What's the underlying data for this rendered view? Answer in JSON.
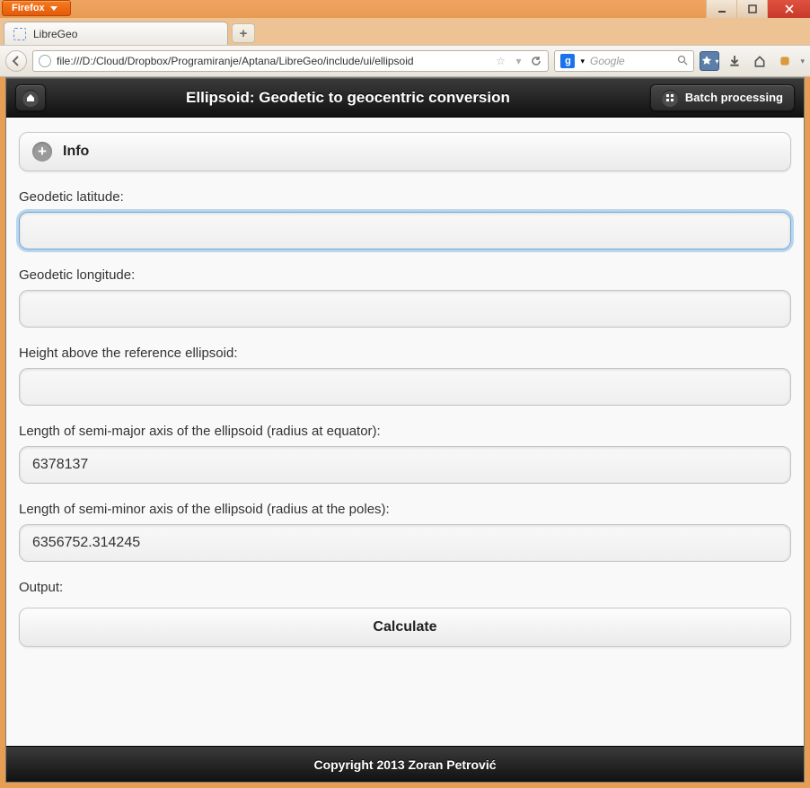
{
  "window": {
    "firefox_button": "Firefox",
    "tab_title": "LibreGeo",
    "url": "file:///D:/Cloud/Dropbox/Programiranje/Aptana/LibreGeo/include/ui/ellipsoid",
    "search_placeholder": "Google"
  },
  "header": {
    "title": "Ellipsoid: Geodetic to geocentric conversion",
    "batch_button": "Batch processing"
  },
  "collapsible": {
    "label": "Info"
  },
  "fields": {
    "lat": {
      "label": "Geodetic latitude:",
      "value": ""
    },
    "lon": {
      "label": "Geodetic longitude:",
      "value": ""
    },
    "h": {
      "label": "Height above the reference ellipsoid:",
      "value": ""
    },
    "a": {
      "label": "Length of semi-major axis of the ellipsoid (radius at equator):",
      "value": "6378137"
    },
    "b": {
      "label": "Length of semi-minor axis of the ellipsoid (radius at the poles):",
      "value": "6356752.314245"
    },
    "output": {
      "label": "Output:"
    }
  },
  "calculate_label": "Calculate",
  "footer": "Copyright 2013 Zoran Petrović"
}
